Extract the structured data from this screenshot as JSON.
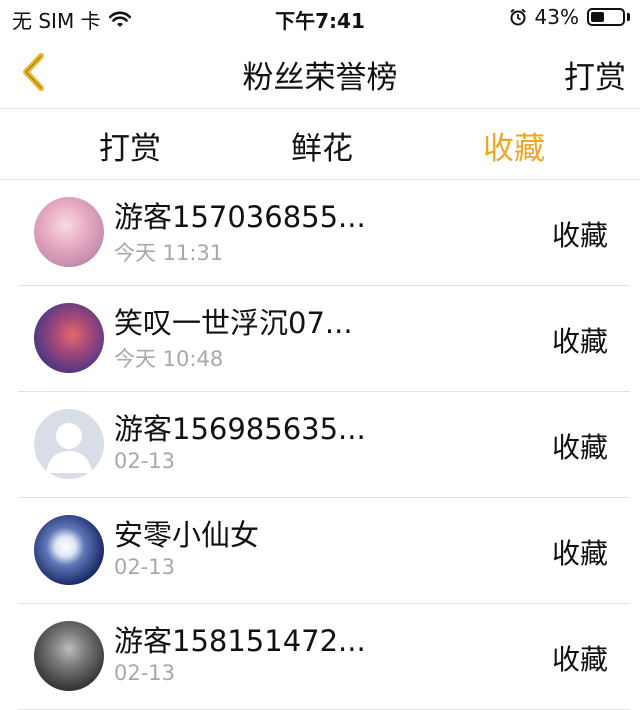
{
  "status_bar": {
    "carrier": "无 SIM 卡",
    "time": "下午7:41",
    "battery_text": "43%",
    "battery_level": 0.43
  },
  "nav": {
    "title": "粉丝荣誉榜",
    "action": "打赏",
    "accent_color": "#F0A623"
  },
  "tabs": [
    {
      "label": "打赏",
      "active": false
    },
    {
      "label": "鲜花",
      "active": false
    },
    {
      "label": "收藏",
      "active": true
    }
  ],
  "rows": [
    {
      "name": "游客157036855...",
      "time": "今天 11:31",
      "action": "收藏"
    },
    {
      "name": "笑叹一世浮沉07...",
      "time": "今天 10:48",
      "action": "收藏"
    },
    {
      "name": "游客156985635...",
      "time": "02-13",
      "action": "收藏"
    },
    {
      "name": "安零小仙女",
      "time": "02-13",
      "action": "收藏"
    },
    {
      "name": "游客158151472...",
      "time": "02-13",
      "action": "收藏"
    }
  ]
}
